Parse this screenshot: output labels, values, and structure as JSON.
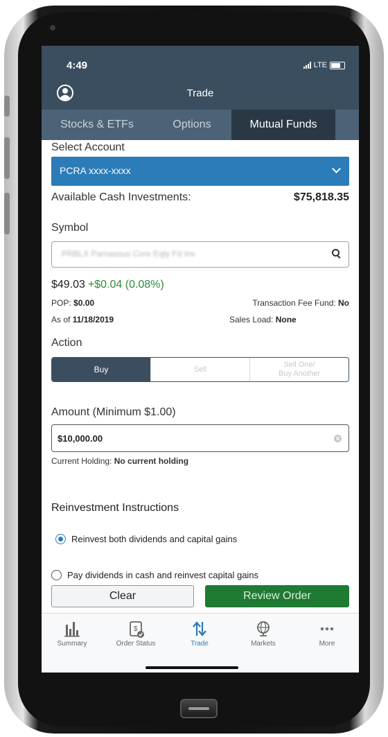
{
  "status_bar": {
    "time": "4:49",
    "network": "LTE"
  },
  "header": {
    "title": "Trade"
  },
  "tabs": [
    {
      "label": "Stocks & ETFs",
      "active": false
    },
    {
      "label": "Options",
      "active": false
    },
    {
      "label": "Mutual Funds",
      "active": true
    }
  ],
  "account": {
    "label": "Select Account",
    "selected": "PCRA xxxx-xxxx"
  },
  "cash": {
    "label": "Available Cash Investments:",
    "value": "$75,818.35"
  },
  "symbol": {
    "label": "Symbol",
    "value": "PRBLX Parnassus Core Eqty Fd Inv"
  },
  "quote": {
    "price": "$49.03",
    "change": "+$0.04 (0.08%)",
    "pop_label": "POP:",
    "pop_value": "$0.00",
    "asof_label": "As of",
    "asof_value": "11/18/2019",
    "tff_label": "Transaction Fee Fund:",
    "tff_value": "No",
    "load_label": "Sales Load:",
    "load_value": "None"
  },
  "action": {
    "label": "Action",
    "buy": "Buy",
    "sell": "Sell",
    "sell_one_line1": "Sell One/",
    "sell_one_line2": "Buy Another",
    "selected": "Buy"
  },
  "amount": {
    "label": "Amount (Minimum $1.00)",
    "value": "$10,000.00",
    "holding_label": "Current Holding:",
    "holding_value": "No current holding"
  },
  "reinvestment": {
    "label": "Reinvestment Instructions",
    "options": [
      {
        "label": "Reinvest both dividends and capital gains",
        "selected": true
      },
      {
        "label": "Pay dividends in cash and reinvest capital gains",
        "selected": false
      }
    ]
  },
  "buttons": {
    "clear": "Clear",
    "review": "Review Order"
  },
  "tabbar": [
    {
      "label": "Summary",
      "icon": "bar-chart-icon",
      "active": false
    },
    {
      "label": "Order Status",
      "icon": "order-status-icon",
      "active": false
    },
    {
      "label": "Trade",
      "icon": "trade-arrows-icon",
      "active": true
    },
    {
      "label": "Markets",
      "icon": "globe-icon",
      "active": false
    },
    {
      "label": "More",
      "icon": "more-dots-icon",
      "active": false
    }
  ],
  "colors": {
    "header": "#3b4e5f",
    "accent": "#2b7cb8",
    "review": "#1f7a34",
    "gain": "#2e8b3a"
  }
}
